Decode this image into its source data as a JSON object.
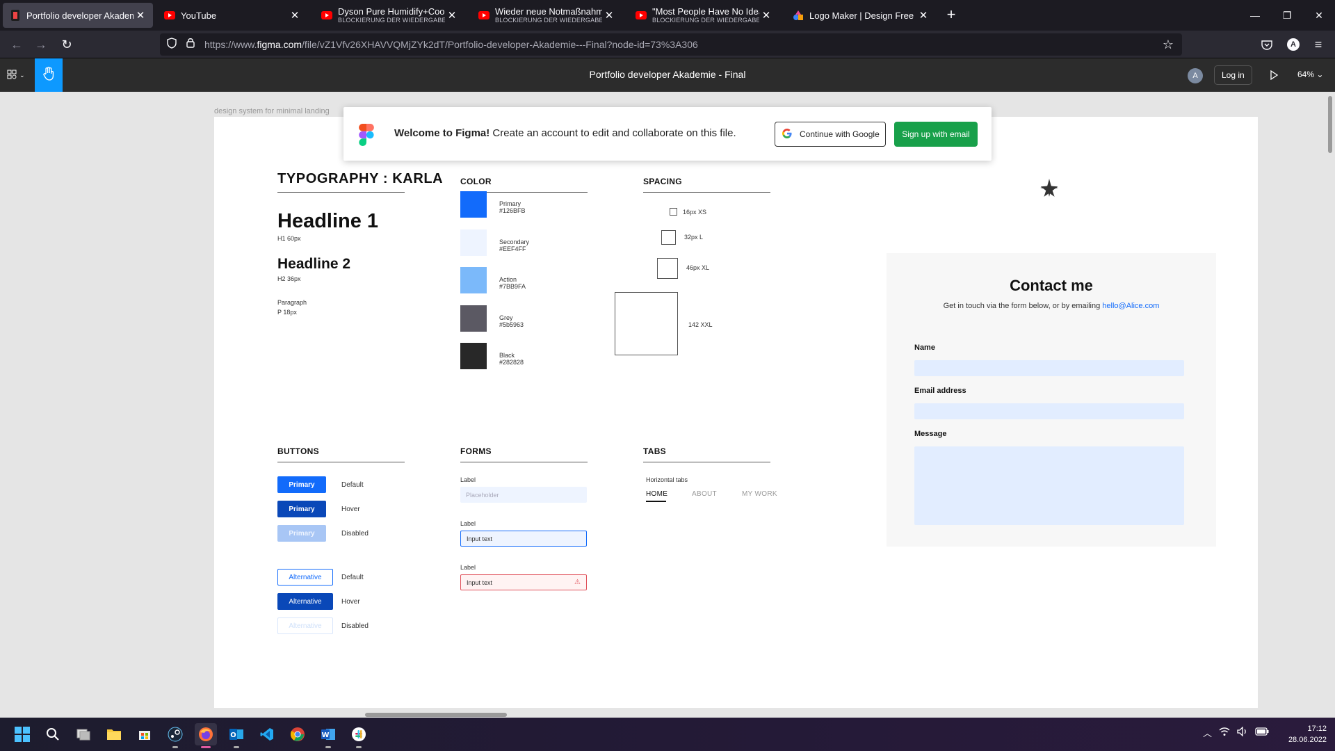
{
  "browser": {
    "tabs": [
      {
        "title": "Portfolio developer Akademie - Final",
        "subtitle": "",
        "icon": "figma-icon",
        "active": true
      },
      {
        "title": "YouTube",
        "subtitle": "",
        "icon": "youtube-icon",
        "active": false
      },
      {
        "title": "Dyson Pure Humidify+Cool nach",
        "subtitle": "BLOCKIERUNG DER WIEDERGABE",
        "icon": "youtube-icon",
        "active": false
      },
      {
        "title": "Wieder neue Notmaßnahmen!",
        "subtitle": "BLOCKIERUNG DER WIEDERGABE",
        "icon": "youtube-icon",
        "active": false
      },
      {
        "title": "\"Most People Have No Idea What",
        "subtitle": "BLOCKIERUNG DER WIEDERGABE",
        "icon": "youtube-icon",
        "active": false
      },
      {
        "title": "Logo Maker | Design Free Custom",
        "subtitle": "",
        "icon": "logo-maker-icon",
        "active": false
      }
    ],
    "url_prefix": "https://www.",
    "url_domain": "figma.com",
    "url_rest": "/file/vZ1Vfv26XHAVVQMjZYk2dT/Portfolio-developer-Akademie---Final?node-id=73%3A306",
    "profile_initial": "A"
  },
  "figma": {
    "file_title": "Portfolio developer Akademie - Final",
    "avatar_initial": "A",
    "login_label": "Log in",
    "zoom": "64%",
    "frame_label": "design system for minimal landing"
  },
  "welcome": {
    "title": "Welcome to Figma!",
    "text": "Create an account to edit and collaborate on this file.",
    "google_label": "Continue with Google",
    "email_label": "Sign up with email"
  },
  "typography": {
    "title": "TYPOGRAPHY : KARLA",
    "h1": "Headline 1",
    "h1_spec": "H1 60px",
    "h2": "Headline 2",
    "h2_spec": "H2 36px",
    "p": "Paragraph",
    "p_spec": "P 18px"
  },
  "color": {
    "title": "COLOR",
    "swatches": [
      {
        "name": "Primary",
        "hex": "#126BFB",
        "color": "#126bfb"
      },
      {
        "name": "Secondary",
        "hex": "#EEF4FF",
        "color": "#eef4ff"
      },
      {
        "name": "Action",
        "hex": "#7BB9FA",
        "color": "#7bb9fa"
      },
      {
        "name": "Grey",
        "hex": "#5b5963",
        "color": "#5b5963"
      },
      {
        "name": "Black",
        "hex": "#282828",
        "color": "#282828"
      }
    ]
  },
  "spacing": {
    "title": "SPACING",
    "items": [
      "16px XS",
      "32px L",
      "46px XL",
      "142 XXL"
    ]
  },
  "buttons": {
    "title": "BUTTONS",
    "primary": "Primary",
    "alternative": "Alternative",
    "states": [
      "Default",
      "Hover",
      "Disabled"
    ]
  },
  "forms": {
    "title": "FORMS",
    "label": "Label",
    "placeholder": "Placeholder",
    "input_text": "Input text"
  },
  "tabs": {
    "title": "TABS",
    "subtitle": "Horizontal tabs",
    "items": [
      "HOME",
      "ABOUT",
      "MY WORK"
    ]
  },
  "contact": {
    "title": "Contact me",
    "subtitle": "Get in touch via the form below, or by emailing",
    "email": "hello@Alice.com",
    "name_label": "Name",
    "email_label": "Email address",
    "message_label": "Message"
  },
  "taskbar": {
    "time": "17:12",
    "date": "28.06.2022"
  }
}
